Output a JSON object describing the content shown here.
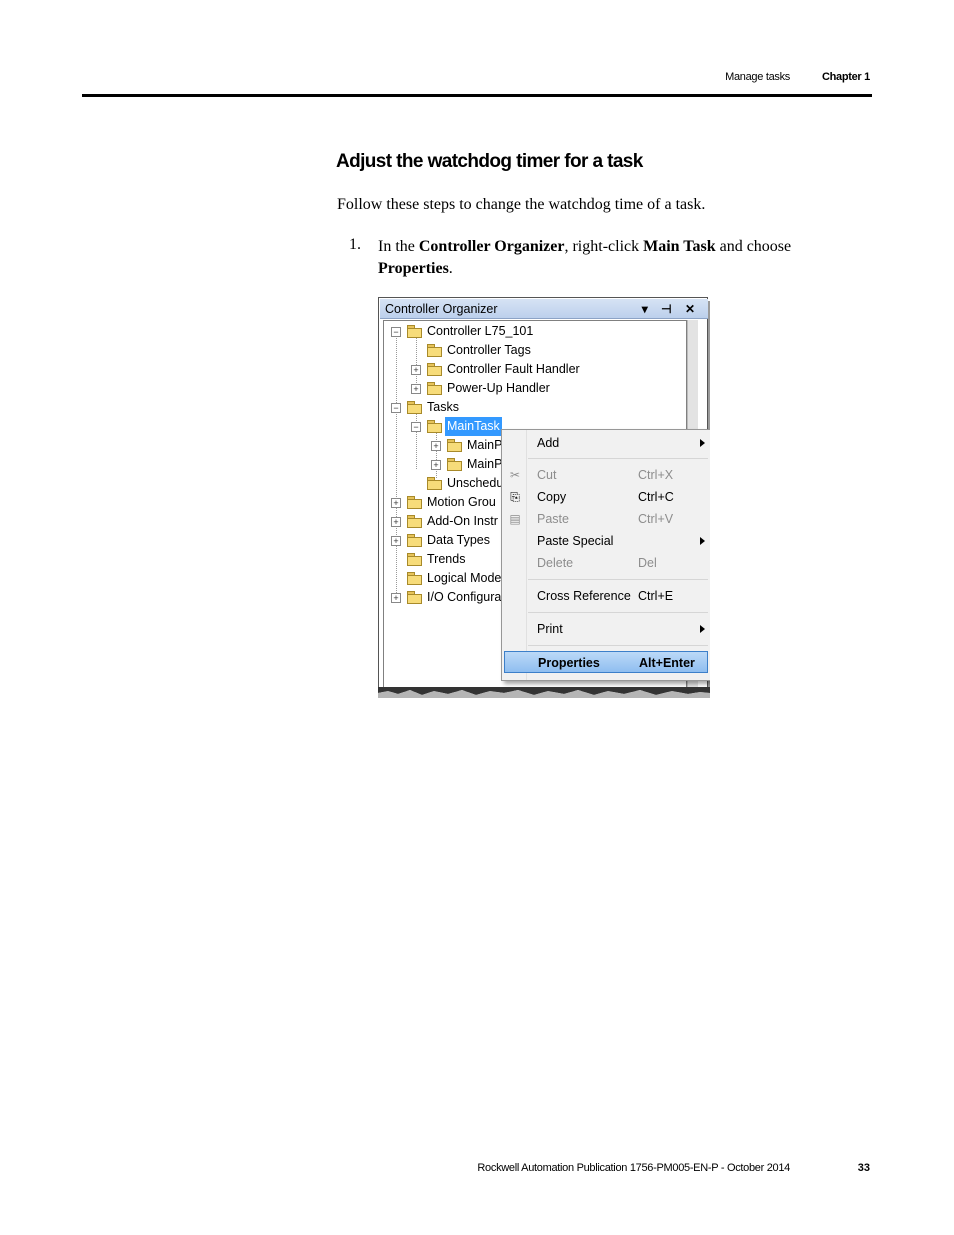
{
  "header": {
    "section": "Manage tasks",
    "chapter": "Chapter 1"
  },
  "title": "Adjust the watchdog timer for a task",
  "intro": "Follow these steps to change the watchdog time of a task.",
  "step1": {
    "number": "1.",
    "parts": [
      "In the ",
      "Controller Organizer",
      ", right-click ",
      "Main Task",
      " and choose ",
      "Properties",
      "."
    ]
  },
  "screenshot": {
    "window_title": "Controller Organizer",
    "title_controls": "▾ ⊣ ✕",
    "tree": [
      {
        "label": "Controller L75_101",
        "icon": "folder-open-icon",
        "expander": "-"
      },
      {
        "label": "Controller Tags",
        "icon": "tags-edit-icon"
      },
      {
        "label": "Controller Fault Handler",
        "icon": "folder-icon",
        "expander": "+"
      },
      {
        "label": "Power-Up Handler",
        "icon": "folder-icon",
        "expander": "+"
      },
      {
        "label": "Tasks",
        "icon": "folder-open-icon",
        "expander": "-"
      },
      {
        "label": "MainTask",
        "icon": "task-icon",
        "expander": "-",
        "selected": true
      },
      {
        "label": "MainP",
        "icon": "program-icon",
        "expander": "+"
      },
      {
        "label": "MainP",
        "icon": "program-icon",
        "expander": "+"
      },
      {
        "label": "Unschedu",
        "icon": "folder-icon"
      },
      {
        "label": "Motion Grou",
        "icon": "folder-icon",
        "expander": "+"
      },
      {
        "label": "Add-On Instr",
        "icon": "folder-icon",
        "expander": "+"
      },
      {
        "label": "Data Types",
        "icon": "folder-icon",
        "expander": "+"
      },
      {
        "label": "Trends",
        "icon": "folder-icon"
      },
      {
        "label": "Logical Mode",
        "icon": "logical-model-icon"
      },
      {
        "label": "I/O Configura",
        "icon": "folder-icon",
        "expander": "+"
      }
    ],
    "context_menu": [
      {
        "label": "Add",
        "shortcut": "",
        "submenu": true,
        "disabled": false
      },
      {
        "label": "Cut",
        "shortcut": "Ctrl+X",
        "disabled": true,
        "icon": "scissors-icon"
      },
      {
        "label": "Copy",
        "shortcut": "Ctrl+C",
        "disabled": false,
        "icon": "copy-icon"
      },
      {
        "label": "Paste",
        "shortcut": "Ctrl+V",
        "disabled": true,
        "icon": "paste-icon"
      },
      {
        "label": "Paste Special",
        "shortcut": "",
        "submenu": true,
        "disabled": false
      },
      {
        "label": "Delete",
        "shortcut": "Del",
        "disabled": true
      },
      {
        "label": "Cross Reference",
        "shortcut": "Ctrl+E",
        "disabled": false
      },
      {
        "label": "Print",
        "shortcut": "",
        "submenu": true,
        "disabled": false
      },
      {
        "label": "Properties",
        "shortcut": "Alt+Enter",
        "disabled": false,
        "highlighted": true
      }
    ]
  },
  "footer": {
    "publication": "Rockwell Automation Publication 1756-PM005-EN-P - October 2014",
    "page": "33"
  }
}
